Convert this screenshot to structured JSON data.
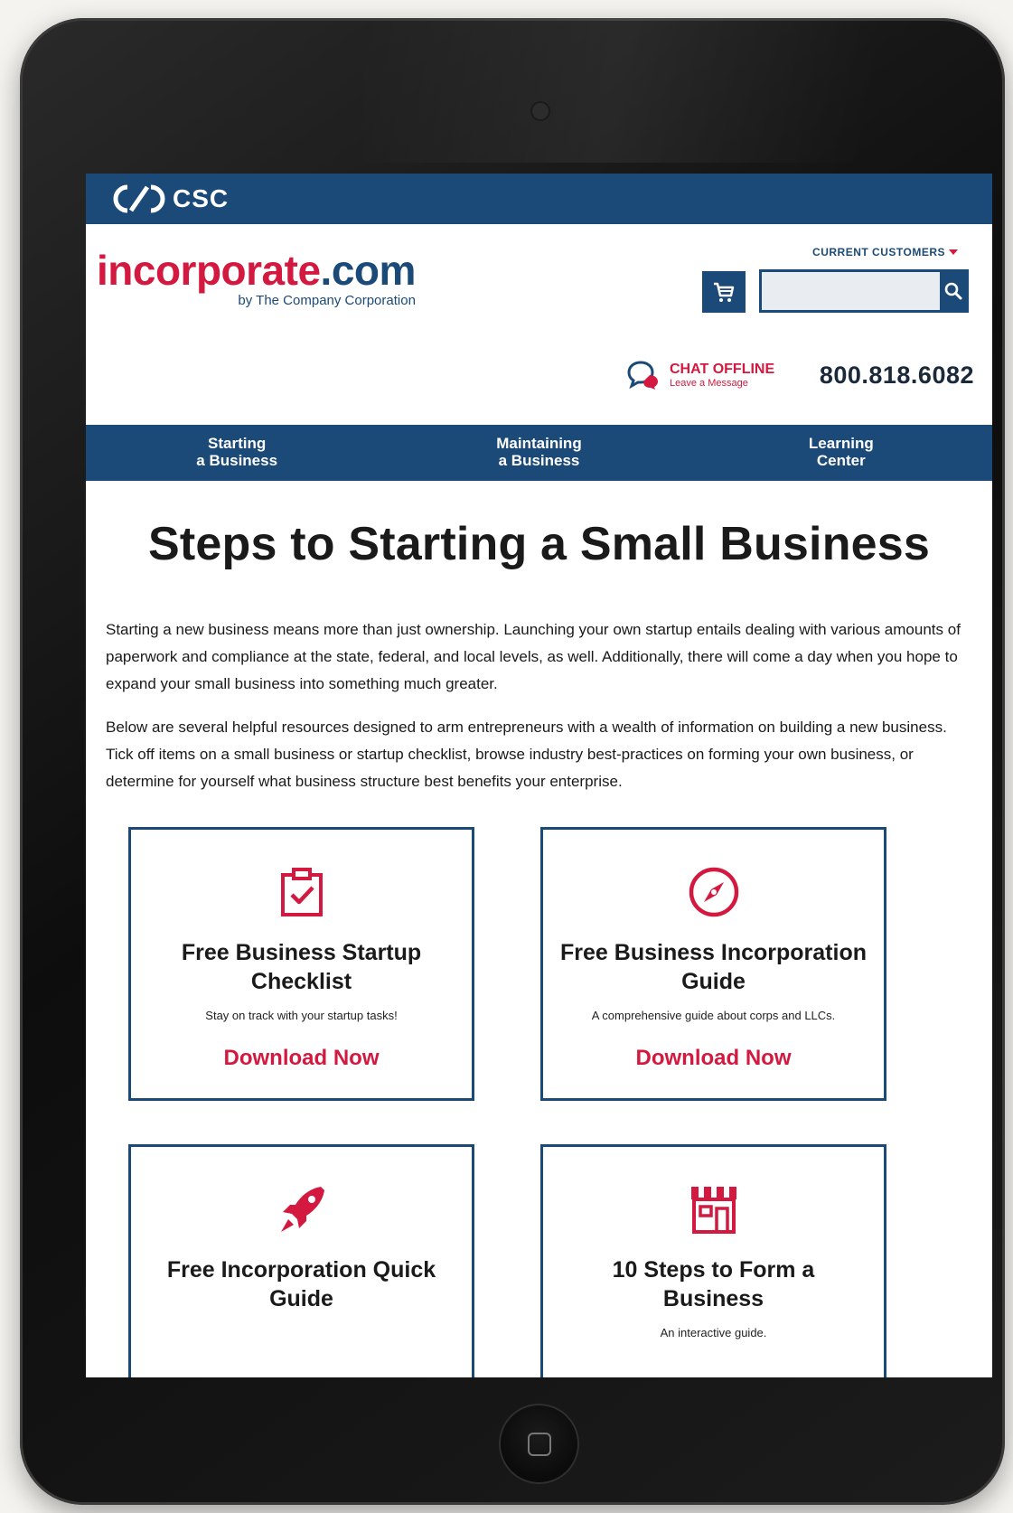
{
  "topbar": {
    "logo_text": "CSC",
    "logo_icon": "csc-logo-icon"
  },
  "brand": {
    "name_part1": "incorporate",
    "name_part2": ".com",
    "tagline": "by The Company Corporation"
  },
  "header": {
    "current_customers_label": "CURRENT CUSTOMERS",
    "search_placeholder": "",
    "chat_status": "CHAT OFFLINE",
    "chat_sub": "Leave a Message",
    "phone": "800.818.6082"
  },
  "nav": {
    "items": [
      {
        "label": "Starting\na Business"
      },
      {
        "label": "Maintaining\na Business"
      },
      {
        "label": "Learning\nCenter"
      }
    ]
  },
  "main": {
    "title": "Steps to Starting a Small Business",
    "paragraphs": [
      "Starting a new business means more than just ownership. Launching your own startup entails dealing with various amounts of paperwork and compliance at the state, federal, and local levels, as well. Additionally, there will come a day when you hope to expand your small business into something much greater.",
      "Below are several helpful resources designed to arm entrepreneurs with a wealth of information on building a new business. Tick off items on a small business or startup checklist, browse industry best-practices on forming your own business, or determine for yourself what business structure best benefits your enterprise."
    ],
    "cards": [
      {
        "icon": "clipboard-check-icon",
        "title": "Free Business Startup Checklist",
        "desc": "Stay on track with your startup tasks!",
        "link": "Download Now"
      },
      {
        "icon": "compass-icon",
        "title": "Free Business Incorporation Guide",
        "desc": "A comprehensive guide about corps and LLCs.",
        "link": "Download Now"
      },
      {
        "icon": "rocket-icon",
        "title": "Free Incorporation Quick Guide",
        "desc": "",
        "link": ""
      },
      {
        "icon": "storefront-icon",
        "title": "10 Steps to Form a Business",
        "desc": "An interactive guide.",
        "link": ""
      }
    ]
  },
  "colors": {
    "brand_blue": "#1b4a78",
    "brand_red": "#d3193f"
  }
}
